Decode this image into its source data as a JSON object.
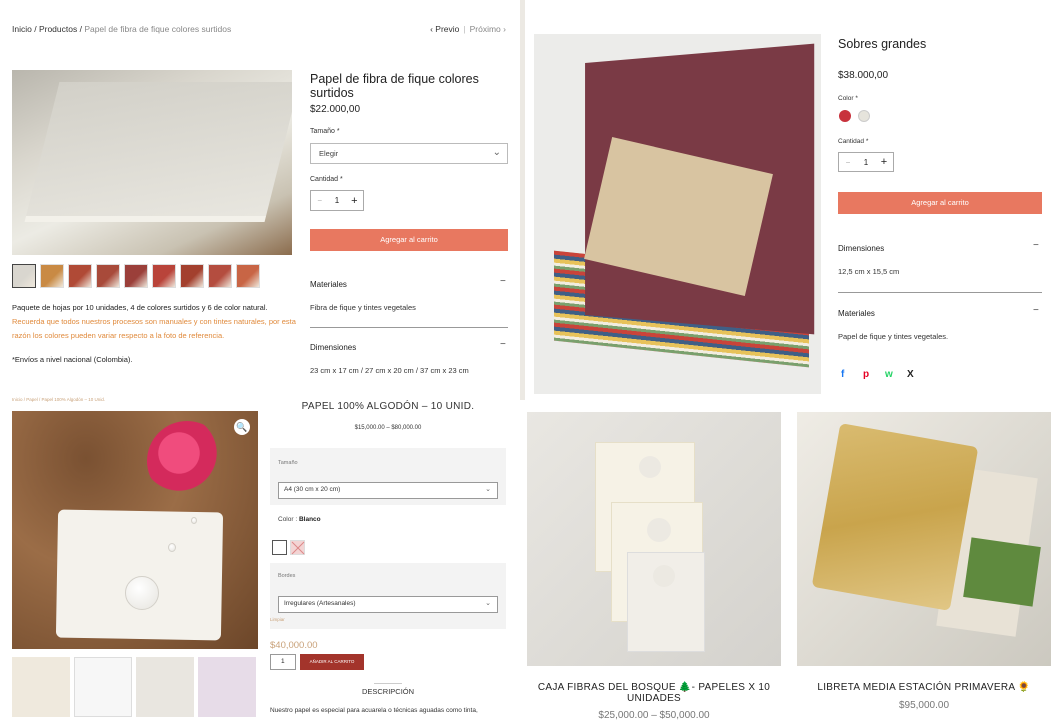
{
  "panel_a": {
    "breadcrumb": {
      "home": "Inicio",
      "sep1": " / ",
      "products": "Productos",
      "sep2": " / ",
      "current": "Papel de fibra de fique colores surtidos"
    },
    "pager": {
      "prev": "Previo",
      "next": "Próximo"
    },
    "title": "Papel de fibra de fique colores surtidos",
    "price": "$22.000,00",
    "size_label": "Tamaño *",
    "size_value": "Elegir",
    "qty_label": "Cantidad *",
    "qty": "1",
    "cart_button": "Agregar al carrito",
    "materials": {
      "title": "Materiales",
      "body": "Fibra de fique y tintes vegetales"
    },
    "dimensions": {
      "title": "Dimensiones",
      "body": "23 cm x 17 cm / 27 cm x 20 cm / 37 cm x 23 cm"
    },
    "description": "Paquete de hojas por 10 unidades, 4 de colores surtidos y 6 de color natural.",
    "warning": "Recuerda que todos nuestros procesos son manuales y con tintes naturales, por esta razón los colores pueden variar respecto a la foto de referencia.",
    "shipping": "*Envíos a nivel nacional (Colombia).",
    "thumb_colors": [
      "#d9d6cf",
      "#c98a44",
      "#b04a36",
      "#a84a3a",
      "#9b3f3a",
      "#b9443a",
      "#a3402e",
      "#b44d3f",
      "#c86545"
    ]
  },
  "panel_b": {
    "title": "Sobres grandes",
    "price": "$38.000,00",
    "color_label": "Color *",
    "swatches": [
      "#c8323c",
      "#e6e4dc"
    ],
    "qty_label": "Cantidad *",
    "qty": "1",
    "cart_button": "Agregar al carrito",
    "dimensions": {
      "title": "Dimensiones",
      "body": "12,5 cm x 15,5 cm"
    },
    "materials": {
      "title": "Materiales",
      "body": "Papel de fique y tintes vegetales."
    },
    "share": {
      "facebook": "f",
      "pinterest": "p",
      "whatsapp": "w",
      "x": "X"
    }
  },
  "panel_c": {
    "breadcrumb": "Inicio / Papel / Papel 100% Algodón – 10 Unid.",
    "title": "PAPEL 100% ALGODÓN – 10 UNID.",
    "range": "$15,000.00 – $80,000.00",
    "size_label": "Tamaño",
    "size_value": "A4 (30 cm x 20 cm)",
    "color_label": "Color : ",
    "color_value": "Blanco",
    "edges_label": "Bordes",
    "edges_value": "Irregulares (Artesanales)",
    "clear": "Limpiar",
    "price": "$40,000.00",
    "qty": "1",
    "add_button": "AÑADIR AL CARRITO",
    "tab": "DESCRIPCIÓN",
    "text": "Nuestro papel es especial para acuarela o técnicas aguadas como tinta,"
  },
  "panel_d": {
    "products": [
      {
        "name": "CAJA FIBRAS DEL BOSQUE 🌲- PAPELES X 10 UNIDADES",
        "price": "$25,000.00 – $50,000.00"
      },
      {
        "name": "LIBRETA MEDIA ESTACIÓN PRIMAVERA 🌻",
        "price": "$95,000.00"
      }
    ]
  }
}
